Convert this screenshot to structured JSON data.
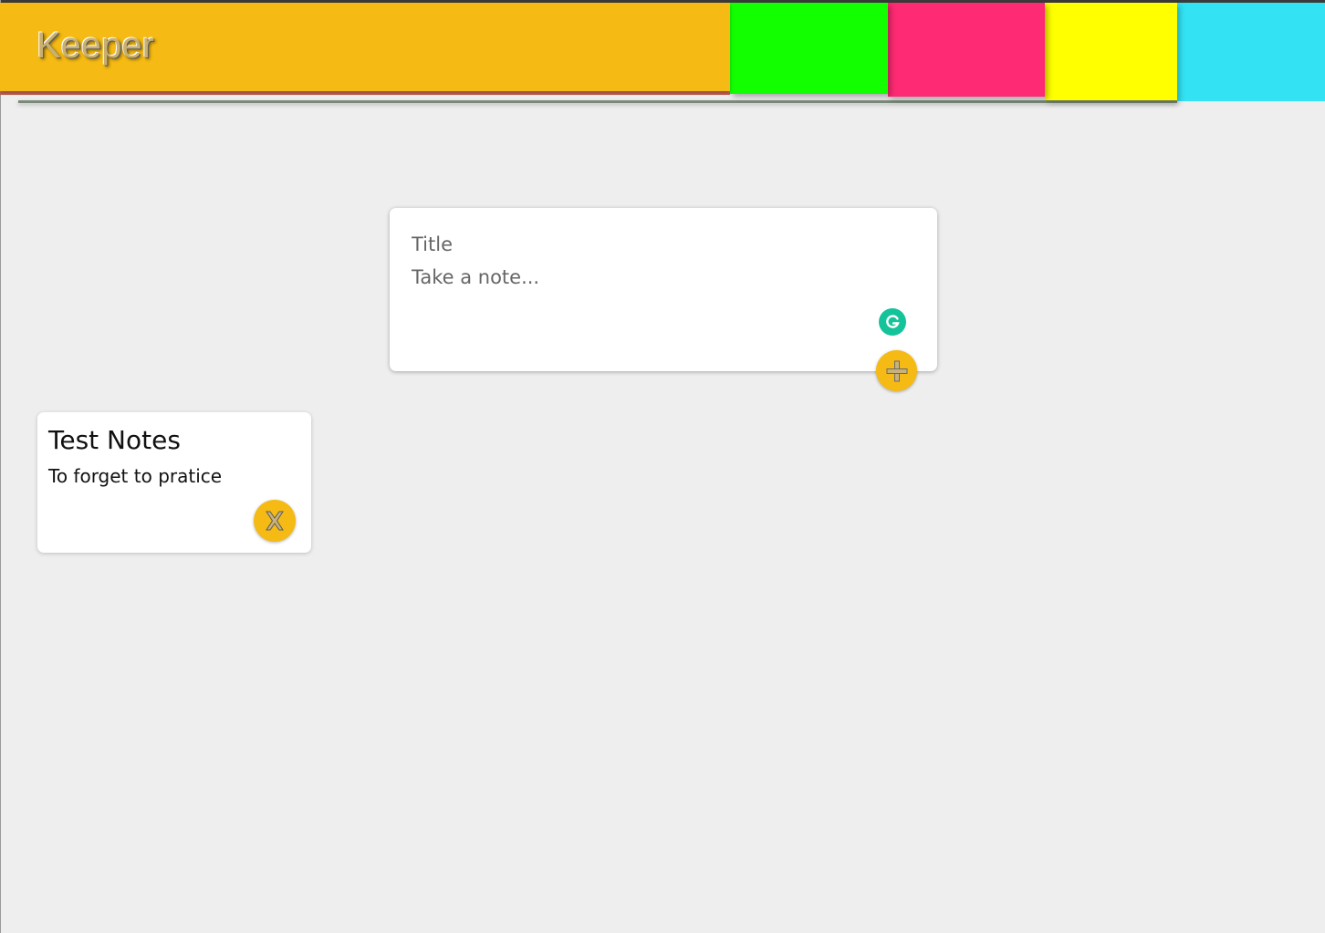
{
  "app": {
    "title": "Keeper"
  },
  "colors": {
    "header_main": "#f5ba13",
    "band_green": "#12ff00",
    "band_pink": "#ff2a74",
    "band_yellow": "#ffff00",
    "band_cyan": "#33e3f4",
    "accent": "#f5ba13",
    "grammarly": "#15c39a",
    "page_background": "#eeeeee"
  },
  "create_note": {
    "title_placeholder": "Title",
    "content_placeholder": "Take a note...",
    "add_icon": "plus-icon",
    "grammarly_icon": "grammarly-icon"
  },
  "notes": [
    {
      "title": "Test Notes",
      "content": "To forget to pratice",
      "delete_icon": "x-icon"
    }
  ]
}
